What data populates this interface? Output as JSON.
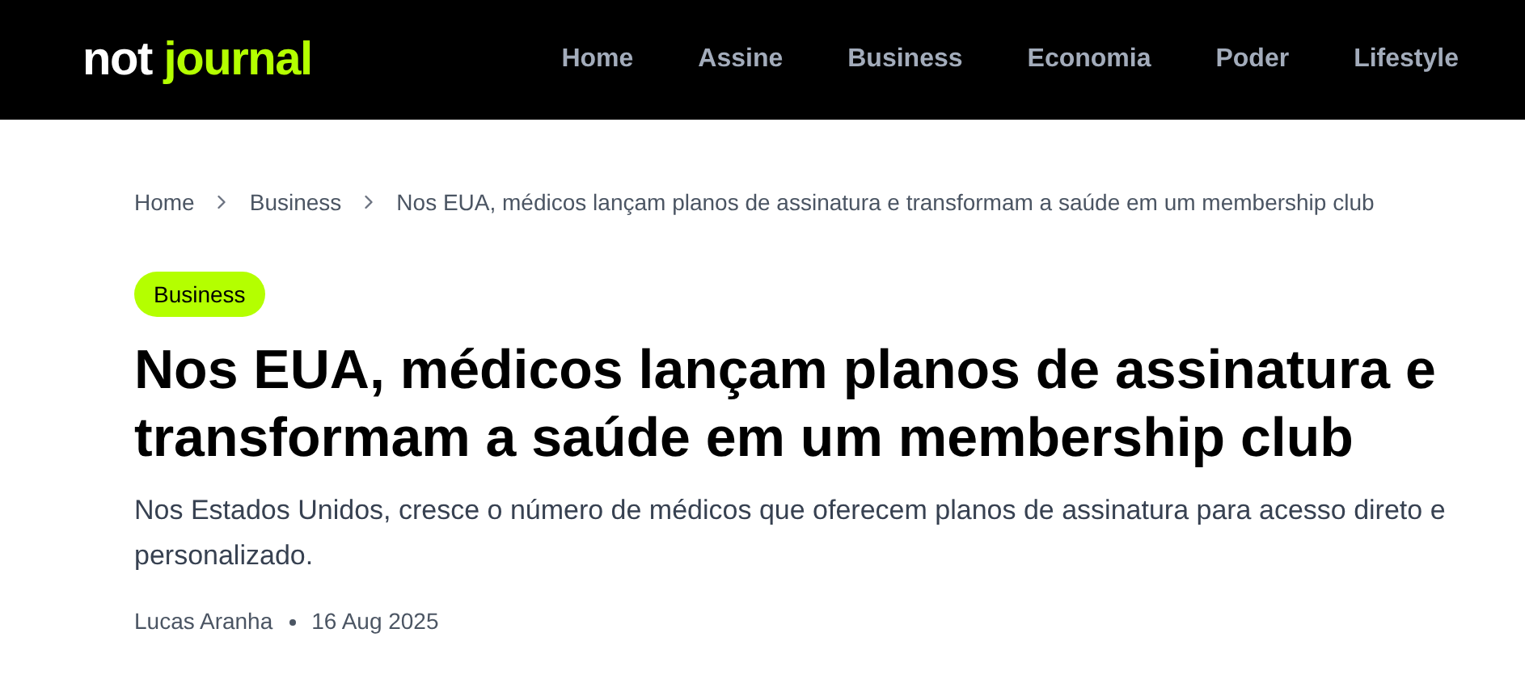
{
  "header": {
    "logo": {
      "first_word": "not",
      "second_word": "journal"
    },
    "nav": [
      {
        "label": "Home"
      },
      {
        "label": "Assine"
      },
      {
        "label": "Business"
      },
      {
        "label": "Economia"
      },
      {
        "label": "Poder"
      },
      {
        "label": "Lifestyle"
      }
    ]
  },
  "breadcrumb": [
    "Home",
    "Business",
    "Nos EUA, médicos lançam planos de assinatura e transformam a saúde em um membership club"
  ],
  "article": {
    "category": "Business",
    "title": "Nos EUA, médicos lançam planos de assinatura e transformam a saúde em um membership club",
    "subtitle": "Nos Estados Unidos, cresce o número de médicos que oferecem planos de assinatura para acesso direto e personalizado.",
    "author": "Lucas Aranha",
    "date": "16 Aug 2025"
  }
}
